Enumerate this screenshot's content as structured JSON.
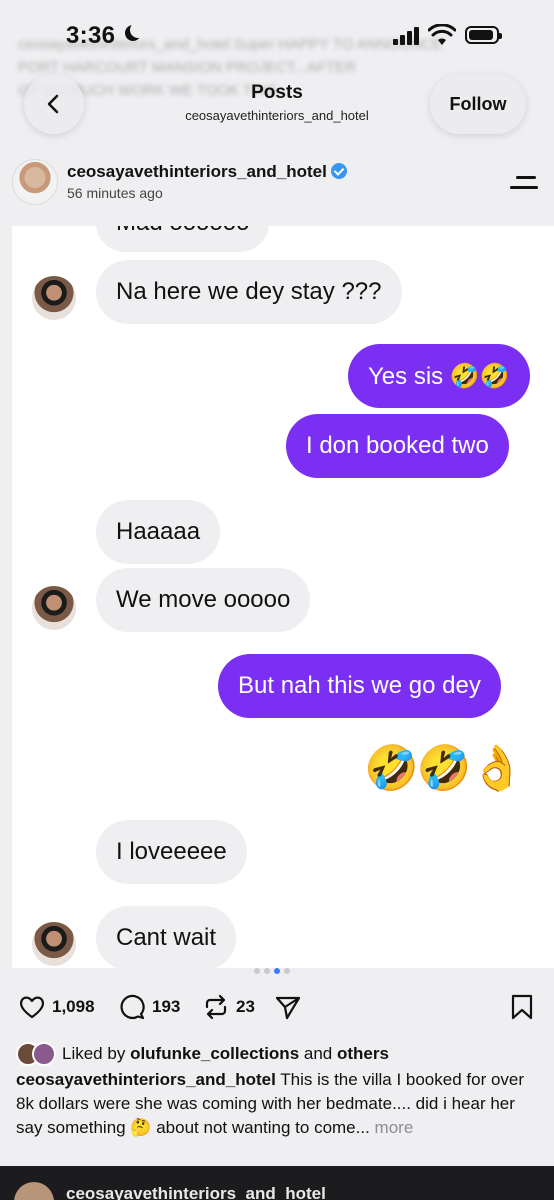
{
  "status": {
    "time": "3:36"
  },
  "background_blur": [
    "ceosayavethinteriors_and_hotel Super HAPPY TO ANNOUNCE",
    "PORT HARCOURT MANSION PROJECT...AFTER",
    "OF SO MUCH WORK WE TOOK THIS..."
  ],
  "header": {
    "title": "Posts",
    "subtitle": "ceosayavethinteriors_and_hotel",
    "follow_label": "Follow"
  },
  "post": {
    "username": "ceosayavethinteriors_and_hotel",
    "time_ago": "56 minutes ago"
  },
  "chat": {
    "partial_top": "Mad oooooo",
    "messages": [
      {
        "side": "in",
        "text": "Na here we dey stay ???"
      },
      {
        "side": "out",
        "text": "Yes sis 🤣🤣"
      },
      {
        "side": "out",
        "text": "I don booked two"
      },
      {
        "side": "in",
        "text": "Haaaaa"
      },
      {
        "side": "in",
        "text": "We move ooooo"
      },
      {
        "side": "out",
        "text": "But nah this we go dey"
      },
      {
        "side": "out",
        "text": "🤣🤣👌"
      },
      {
        "side": "in",
        "text": "I loveeeee"
      },
      {
        "side": "in",
        "text": "Cant wait"
      }
    ]
  },
  "carousel": {
    "count": 4,
    "active": 2
  },
  "actions": {
    "likes": "1,098",
    "comments": "193",
    "reposts": "23"
  },
  "liked_by": {
    "prefix": "Liked by",
    "user": "olufunke_collections",
    "middle": "and",
    "suffix": "others"
  },
  "caption": {
    "username": "ceosayavethinteriors_and_hotel",
    "text": "This is the villa I booked for over 8k dollars were she was coming with her bedmate.... did i hear her say something 🤔 about not wanting to come...",
    "more": "more"
  },
  "next_post": {
    "username": "ceosayavethinteriors_and_hotel"
  },
  "colors": {
    "outgoing": "#7b2ff2",
    "incoming": "#efeff1",
    "verified": "#3897f0"
  }
}
